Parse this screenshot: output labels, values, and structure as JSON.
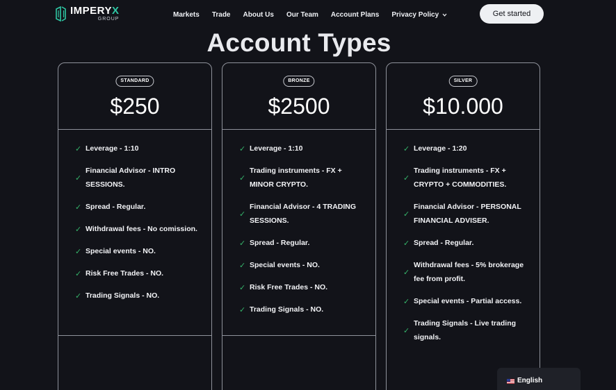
{
  "brand": {
    "name_prefix": "IMPERY",
    "name_accent": "X",
    "subtitle": "GROUP",
    "accent_color": "#2fc7a4"
  },
  "nav": {
    "items": [
      "Markets",
      "Trade",
      "About Us",
      "Our Team",
      "Account Plans"
    ],
    "dropdown_label": "Privacy Policy",
    "dropdown_icon": "chevron-down-icon"
  },
  "cta": {
    "label": "Get started"
  },
  "page": {
    "title": "Account Types"
  },
  "plans": [
    {
      "badge": "STANDARD",
      "price": "$250",
      "features": [
        "Leverage - 1:10",
        "Financial Advisor - INTRO SESSIONS.",
        "Spread - Regular.",
        "Withdrawal fees - No comission.",
        "Special events - NO.",
        "Risk Free Trades - NO.",
        "Trading Signals - NO."
      ]
    },
    {
      "badge": "BRONZE",
      "price": "$2500",
      "features": [
        "Leverage - 1:10",
        "Trading instruments - FX + MINOR CRYPTO.",
        "Financial Advisor - 4 TRADING SESSIONS.",
        "Spread - Regular.",
        "Special events - NO.",
        "Risk Free Trades - NO.",
        "Trading Signals - NO."
      ]
    },
    {
      "badge": "SILVER",
      "price": "$10.000",
      "features": [
        "Leverage - 1:20",
        "Trading instruments - FX + CRYPTO + COMMODITIES.",
        "Financial Advisor - PERSONAL FINANCIAL ADVISER.",
        "Spread - Regular.",
        "Withdrawal fees - 5% brokerage fee from profit.",
        "Special events - Partial access.",
        "Trading Signals - Live trading signals."
      ]
    }
  ],
  "feature_icon": "check-icon",
  "check_color": "#35b36a",
  "language": {
    "label": "English",
    "flag_icon": "us-flag-icon"
  }
}
